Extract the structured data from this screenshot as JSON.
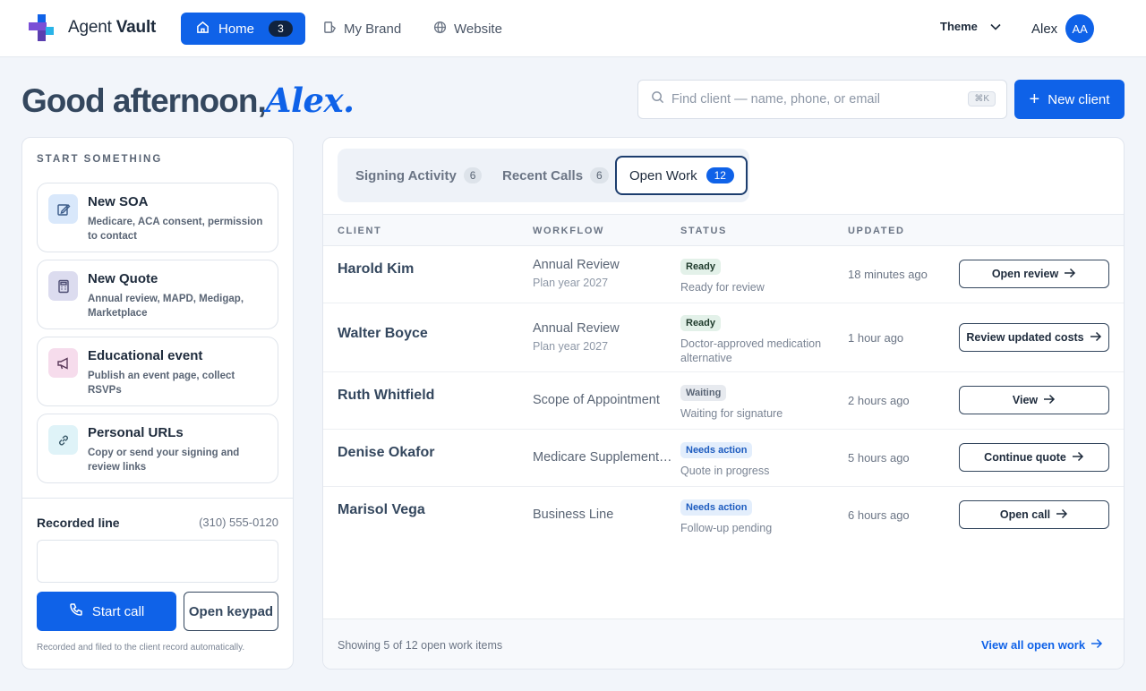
{
  "brand": {
    "name_regular": "Agent",
    "name_bold": "Vault"
  },
  "nav": {
    "home_label": "Home",
    "home_count": "3",
    "brand_label": "My Brand",
    "website_label": "Website"
  },
  "header": {
    "theme_label": "Theme",
    "user_name": "Alex",
    "avatar_initials": "AA"
  },
  "greeting": {
    "text": "Good afternoon,",
    "name": "Alex."
  },
  "search": {
    "placeholder": "Find client — name, phone, or email",
    "shortcut": "⌘K"
  },
  "new_client_label": "New client",
  "start": {
    "title": "START SOMETHING",
    "actions": [
      {
        "title": "New SOA",
        "desc": "Medicare, ACA consent, permission to contact",
        "icon": "edit-icon"
      },
      {
        "title": "New Quote",
        "desc": "Annual review, MAPD, Medigap, Marketplace",
        "icon": "calculator-icon"
      },
      {
        "title": "Educational event",
        "desc": "Publish an event page, collect RSVPs",
        "icon": "megaphone-icon"
      },
      {
        "title": "Personal URLs",
        "desc": "Copy or send your signing and review links",
        "icon": "link-icon"
      }
    ]
  },
  "recorded": {
    "title": "Recorded line",
    "phone": "(310) 555-0120",
    "start_call": "Start call",
    "keypad": "Open keypad",
    "note": "Recorded and filed to the client record automatically."
  },
  "tabs": [
    {
      "label": "Signing Activity",
      "count": "6"
    },
    {
      "label": "Recent Calls",
      "count": "6"
    },
    {
      "label": "Open Work",
      "count": "12"
    }
  ],
  "table": {
    "headers": [
      "CLIENT",
      "WORKFLOW",
      "STATUS",
      "UPDATED"
    ],
    "rows": [
      {
        "client": "Harold Kim",
        "workflow": "Annual Review",
        "workflow_sub": "Plan year 2027",
        "status": "Ready",
        "status_sub": "Ready for review",
        "updated": "18 minutes ago",
        "action": "Open review"
      },
      {
        "client": "Walter Boyce",
        "workflow": "Annual Review",
        "workflow_sub": "Plan year 2027",
        "status": "Ready",
        "status_sub": "Doctor-approved medication alternative",
        "updated": "1 hour ago",
        "action": "Review updated costs"
      },
      {
        "client": "Ruth Whitfield",
        "workflow": "Scope of Appointment",
        "workflow_sub": "",
        "status": "Waiting",
        "status_sub": "Waiting for signature",
        "updated": "2 hours ago",
        "action": "View"
      },
      {
        "client": "Denise Okafor",
        "workflow": "Medicare Supplement…",
        "workflow_sub": "",
        "status": "Needs action",
        "status_sub": "Quote in progress",
        "updated": "5 hours ago",
        "action": "Continue quote"
      },
      {
        "client": "Marisol Vega",
        "workflow": "Business Line",
        "workflow_sub": "",
        "status": "Needs action",
        "status_sub": "Follow-up pending",
        "updated": "6 hours ago",
        "action": "Open call"
      }
    ],
    "footer_text": "Showing 5 of 12 open work items",
    "view_all": "View all open work"
  },
  "colors": {
    "accent": "#0f62e8",
    "ready_bg": "#e3f1e9",
    "waiting_bg": "#e7eaef",
    "needs_bg": "#e3eefc"
  }
}
